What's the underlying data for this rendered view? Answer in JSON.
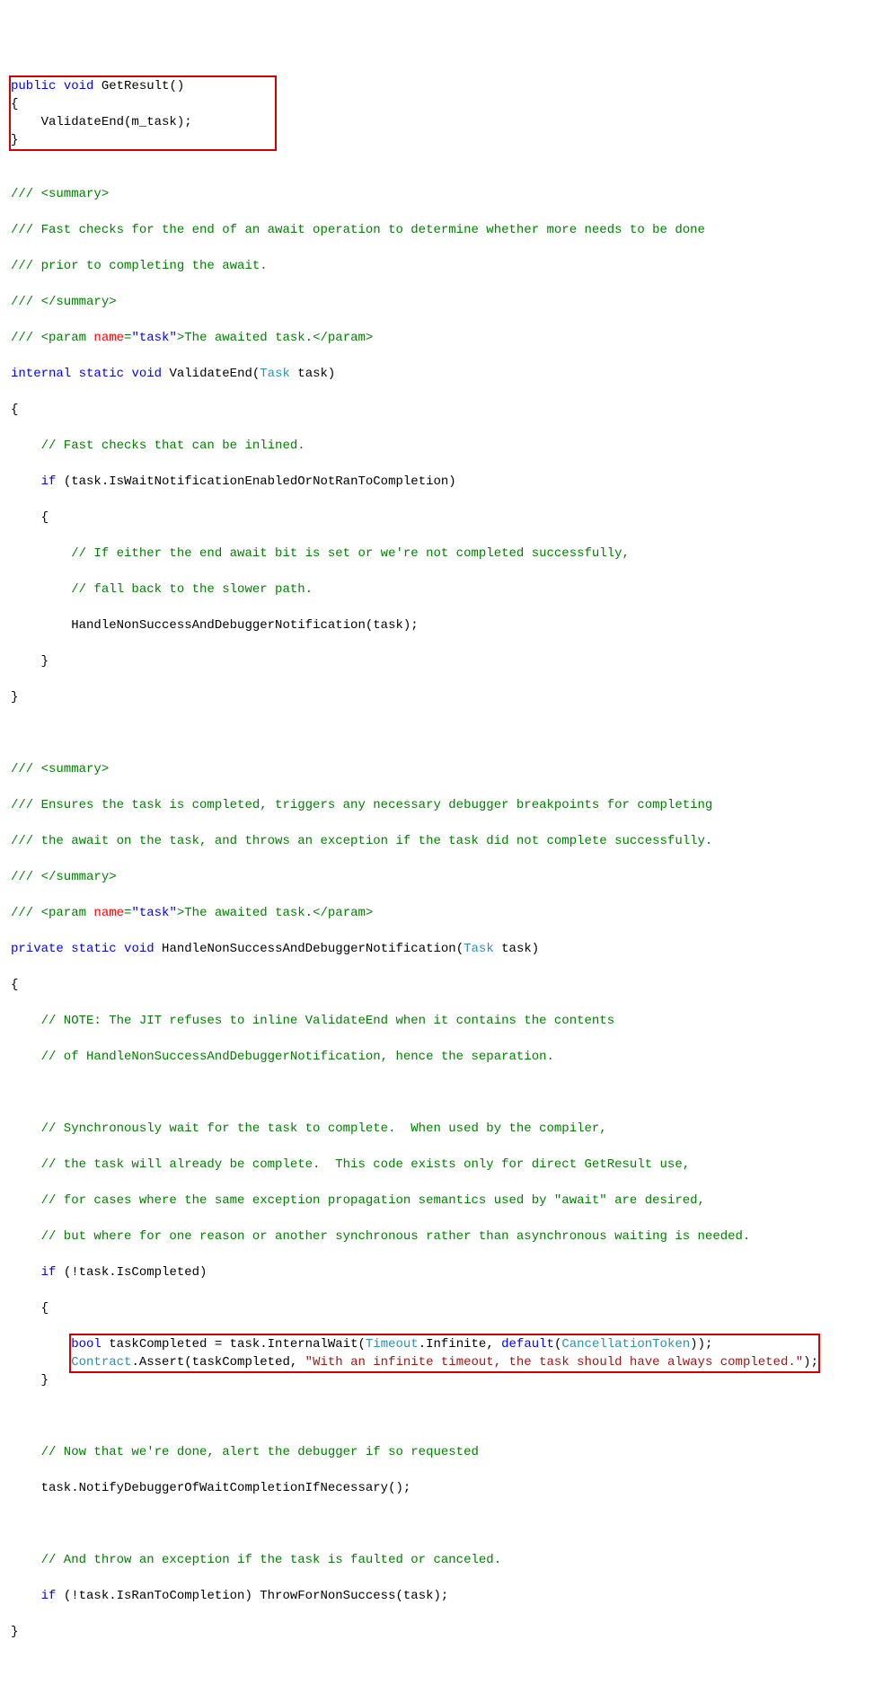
{
  "code": {
    "b1": {
      "l1a": "public",
      "l1b": "void",
      "l1c": " GetResult()",
      "l2": "{",
      "l3": "    ValidateEnd(m_task);",
      "l4": "}"
    },
    "blank1": " ",
    "c1": "/// <summary>",
    "c2": "/// Fast checks for the end of an await operation to determine whether more needs to be done",
    "c3": "/// prior to completing the await.",
    "c4": "/// </summary>",
    "c5a": "/// <param ",
    "c5b": "name",
    "c5c": "=",
    "c5d": "\"task\"",
    "c5e": ">The awaited task.</param>",
    "m1a": "internal",
    "m1b": "static",
    "m1c": "void",
    "m1d": " ValidateEnd(",
    "m1e": "Task",
    "m1f": " task)",
    "m2": "{",
    "m3": "    // Fast checks that can be inlined.",
    "m4a": "    ",
    "m4b": "if",
    "m4c": " (task.IsWaitNotificationEnabledOrNotRanToCompletion)",
    "m5": "    {",
    "m6": "        // If either the end await bit is set or we're not completed successfully,",
    "m7": "        // fall back to the slower path.",
    "m8": "        HandleNonSuccessAndDebuggerNotification(task);",
    "m9": "    }",
    "m10": "}",
    "blank2": " ",
    "d1": "/// <summary>",
    "d2": "/// Ensures the task is completed, triggers any necessary debugger breakpoints for completing",
    "d3": "/// the await on the task, and throws an exception if the task did not complete successfully.",
    "d4": "/// </summary>",
    "d5a": "/// <param ",
    "d5b": "name",
    "d5c": "=",
    "d5d": "\"task\"",
    "d5e": ">The awaited task.</param>",
    "n1a": "private",
    "n1b": "static",
    "n1c": "void",
    "n1d": " HandleNonSuccessAndDebuggerNotification(",
    "n1e": "Task",
    "n1f": " task)",
    "n2": "{",
    "n3": "    // NOTE: The JIT refuses to inline ValidateEnd when it contains the contents",
    "n4": "    // of HandleNonSuccessAndDebuggerNotification, hence the separation.",
    "blank3": " ",
    "n5": "    // Synchronously wait for the task to complete.  When used by the compiler,",
    "n6": "    // the task will already be complete.  This code exists only for direct GetResult use,",
    "n7": "    // for cases where the same exception propagation semantics used by \"await\" are desired,",
    "n8": "    // but where for one reason or another synchronous rather than asynchronous waiting is needed.",
    "n9a": "    ",
    "n9b": "if",
    "n9c": " (!task.IsCompleted)",
    "n10": "    {",
    "b2": {
      "pad": "        ",
      "l1a": "bool",
      "l1b": " taskCompleted = task.InternalWait(",
      "l1c": "Timeout",
      "l1d": ".Infinite, ",
      "l1e": "default",
      "l1f": "(",
      "l1g": "CancellationToken",
      "l1h": "));",
      "l2a": "Contract",
      "l2b": ".Assert(taskCompleted, ",
      "l2c": "\"With an infinite timeout, the task should have always completed.\"",
      "l2d": ");"
    },
    "n11": "    }",
    "blank4": " ",
    "n12": "    // Now that we're done, alert the debugger if so requested",
    "n13": "    task.NotifyDebuggerOfWaitCompletionIfNecessary();",
    "blank5": " ",
    "n14": "    // And throw an exception if the task is faulted or canceled.",
    "n15a": "    ",
    "n15b": "if",
    "n15c": " (!task.IsRanToCompletion) ThrowForNonSuccess(task);",
    "n16": "}"
  }
}
